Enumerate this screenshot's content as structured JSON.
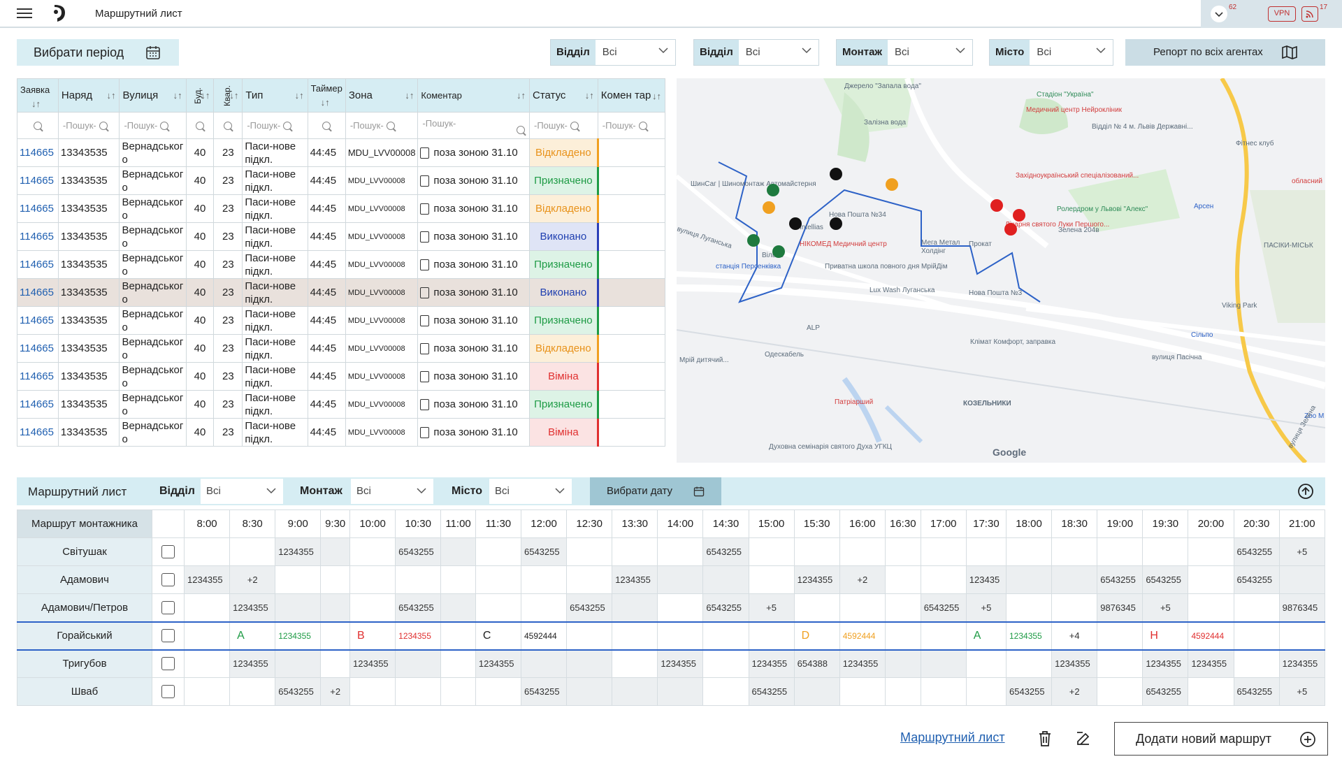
{
  "app": {
    "title": "Маршрутний лист",
    "badge_count": "62",
    "vpn_label": "VPN",
    "rss_count": "17"
  },
  "filters": {
    "period_label": "Вибрати період",
    "groups": [
      {
        "label": "Відділ",
        "value": "Всі"
      },
      {
        "label": "Відділ",
        "value": "Всі"
      },
      {
        "label": "Монтаж",
        "value": "Всі"
      },
      {
        "label": "Місто",
        "value": "Всі"
      }
    ],
    "report_label": "Репорт по всіх агентах"
  },
  "table": {
    "headers": [
      "Заявка",
      "Наряд",
      "Вулиця",
      "Буд.",
      "Квар.",
      "Тип",
      "Таймер",
      "Зона",
      "Коментар",
      "Статус",
      "Комен тар"
    ],
    "search_placeholder": "-Пошук-",
    "rows": [
      {
        "id": "114665",
        "order": "13343535",
        "street": "Вернадського",
        "bld": "40",
        "apt": "23",
        "type": "Паси-нове підкл.",
        "timer": "44:45",
        "zone": "MDU_LVV00008",
        "comment": "поза зоною 31.10",
        "status": "Відкладено",
        "s": "o"
      },
      {
        "id": "114665",
        "order": "13343535",
        "street": "Вернадського",
        "bld": "40",
        "apt": "23",
        "type": "Паси-нове підкл.",
        "timer": "44:45",
        "zone": "MDU_LVV00008",
        "comment": "поза зоною 31.10",
        "status": "Призначено",
        "s": "g"
      },
      {
        "id": "114665",
        "order": "13343535",
        "street": "Вернадського",
        "bld": "40",
        "apt": "23",
        "type": "Паси-нове підкл.",
        "timer": "44:45",
        "zone": "MDU_LVV00008",
        "comment": "поза зоною 31.10",
        "status": "Відкладено",
        "s": "o"
      },
      {
        "id": "114665",
        "order": "13343535",
        "street": "Вернадського",
        "bld": "40",
        "apt": "23",
        "type": "Паси-нове підкл.",
        "timer": "44:45",
        "zone": "MDU_LVV00008",
        "comment": "поза зоною 31.10",
        "status": "Виконано",
        "s": "b"
      },
      {
        "id": "114665",
        "order": "13343535",
        "street": "Вернадського",
        "bld": "40",
        "apt": "23",
        "type": "Паси-нове підкл.",
        "timer": "44:45",
        "zone": "MDU_LVV00008",
        "comment": "поза зоною 31.10",
        "status": "Призначено",
        "s": "g"
      },
      {
        "id": "114665",
        "order": "13343535",
        "street": "Вернадського",
        "bld": "40",
        "apt": "23",
        "type": "Паси-нове підкл.",
        "timer": "44:45",
        "zone": "MDU_LVV00008",
        "comment": "поза зоною 31.10",
        "status": "Виконано",
        "s": "b",
        "hl": true
      },
      {
        "id": "114665",
        "order": "13343535",
        "street": "Вернадського",
        "bld": "40",
        "apt": "23",
        "type": "Паси-нове підкл.",
        "timer": "44:45",
        "zone": "MDU_LVV00008",
        "comment": "поза зоною 31.10",
        "status": "Призначено",
        "s": "g"
      },
      {
        "id": "114665",
        "order": "13343535",
        "street": "Вернадського",
        "bld": "40",
        "apt": "23",
        "type": "Паси-нове підкл.",
        "timer": "44:45",
        "zone": "MDU_LVV00008",
        "comment": "поза зоною 31.10",
        "status": "Відкладено",
        "s": "o"
      },
      {
        "id": "114665",
        "order": "13343535",
        "street": "Вернадського",
        "bld": "40",
        "apt": "23",
        "type": "Паси-нове підкл.",
        "timer": "44:45",
        "zone": "MDU_LVV00008",
        "comment": "поза зоною 31.10",
        "status": "Віміна",
        "s": "r"
      },
      {
        "id": "114665",
        "order": "13343535",
        "street": "Вернадського",
        "bld": "40",
        "apt": "23",
        "type": "Паси-нове підкл.",
        "timer": "44:45",
        "zone": "MDU_LVV00008",
        "comment": "поза зоною 31.10",
        "status": "Призначено",
        "s": "g"
      },
      {
        "id": "114665",
        "order": "13343535",
        "street": "Вернадського",
        "bld": "40",
        "apt": "23",
        "type": "Паси-нове підкл.",
        "timer": "44:45",
        "zone": "MDU_LVV00008",
        "comment": "поза зоною 31.10",
        "status": "Віміна",
        "s": "r"
      }
    ]
  },
  "map": {
    "labels": [
      "Джерело \"Запала вода\"",
      "Залізна вода",
      "Стадіон \"Україна\"",
      "Медичний центр Нейрокліник",
      "Відділ № 4 м. Львів Державні...",
      "Фітнес клуб",
      "Західноукраїнський спеціалізований...",
      "обласний",
      "Арсен",
      "ШинСаг | Шиномонтаж Автомайстерня",
      "Intellias",
      "Нова Пошта №34",
      "НІКОМЕД Медичний центр",
      "Мега Метал",
      "Холдінг",
      "Прокат",
      "Лікарня святого Луки Першого...",
      "Ролердром у Львові \"Алекс\"",
      "Зелена 204в",
      "ПАСІКИ-МІСЬК",
      "вулиця Луганська",
      "Вільне",
      "станція Персенківка",
      "Приватна школа повного дня МрійДім",
      "Lux Wash Луганська",
      "Нова Пошта №3",
      "Viking Park",
      "ALP",
      "Одескабель",
      "Клімат Комфорт, заправка",
      "Сільпо",
      "вулиця Пасічна",
      "Мрій дитячий...",
      "Патріарший",
      "КОЗЕЛЬНИКИ",
      "Духовна семінарія святого Духа УГКЦ",
      "Zoo M",
      "вулиця Зелена"
    ],
    "brand": "Google"
  },
  "route": {
    "title": "Маршрутний лист",
    "filters": [
      {
        "label": "Відділ",
        "value": "Всі"
      },
      {
        "label": "Монтаж",
        "value": "Всі"
      },
      {
        "label": "Місто",
        "value": "Всі"
      }
    ],
    "date_btn": "Вибрати дату",
    "corner_label": "Маршрут монтажника",
    "times": [
      "8:00",
      "8:30",
      "9:00",
      "9:30",
      "10:00",
      "10:30",
      "11:00",
      "11:30",
      "12:00",
      "12:30",
      "13:30",
      "14:00",
      "14:30",
      "15:00",
      "15:30",
      "16:00",
      "16:30",
      "17:00",
      "17:30",
      "18:00",
      "18:30",
      "19:00",
      "19:30",
      "20:00",
      "20:30",
      "21:00"
    ],
    "rows": [
      {
        "name": "Світушак",
        "cells": [
          "",
          "",
          "1234355",
          "",
          "",
          "6543255",
          "",
          "",
          "6543255",
          "",
          "",
          "",
          "6543255",
          "",
          "",
          "",
          "",
          "",
          "",
          "",
          "",
          "",
          "",
          "",
          "6543255",
          "+5"
        ],
        "g": [
          0,
          0,
          1,
          1,
          0,
          1,
          1,
          0,
          1,
          0,
          0,
          0,
          1,
          0,
          0,
          0,
          0,
          0,
          0,
          0,
          0,
          0,
          0,
          0,
          1,
          1
        ]
      },
      {
        "name": "Адамович",
        "cells": [
          "1234355",
          "+2",
          "",
          "",
          "",
          "",
          "",
          "",
          "",
          "",
          "1234355",
          "",
          "",
          "",
          "1234355",
          "+2",
          "",
          "",
          "123435",
          "",
          "",
          "6543255",
          "6543255",
          "",
          "6543255",
          ""
        ],
        "g": [
          1,
          1,
          0,
          0,
          0,
          0,
          0,
          0,
          0,
          0,
          1,
          1,
          1,
          0,
          1,
          1,
          0,
          0,
          1,
          1,
          1,
          1,
          1,
          0,
          1,
          1
        ]
      },
      {
        "name": "Адамович/Петров",
        "cells": [
          "",
          "1234355",
          "",
          "",
          "",
          "6543255",
          "",
          "",
          "",
          "6543255",
          "",
          "",
          "6543255",
          "+5",
          "",
          "",
          "",
          "6543255",
          "+5",
          "",
          "",
          "9876345",
          "+5",
          "",
          "",
          "9876345"
        ],
        "g": [
          0,
          1,
          1,
          1,
          0,
          1,
          1,
          0,
          0,
          1,
          1,
          0,
          1,
          1,
          0,
          0,
          0,
          1,
          1,
          0,
          0,
          1,
          1,
          0,
          0,
          1
        ]
      },
      {
        "name": "Горайський",
        "cells": [
          "",
          "A",
          "1234355",
          "",
          "B",
          "1234355",
          "",
          "C",
          "4592444",
          "",
          "",
          "",
          "",
          "",
          "D",
          "4592444",
          "",
          "",
          "A",
          "1234355",
          "+4",
          "",
          "Н",
          "4592444",
          "",
          ""
        ],
        "sel": true
      },
      {
        "name": "Тригубов",
        "cells": [
          "",
          "1234355",
          "",
          "",
          "1234355",
          "",
          "",
          "1234355",
          "",
          "",
          "",
          "1234355",
          "",
          "1234355",
          "654388",
          "1234355",
          "",
          "",
          "",
          "",
          "1234355",
          "",
          "1234355",
          "1234355",
          "",
          "1234355"
        ],
        "g": [
          0,
          1,
          1,
          0,
          1,
          1,
          0,
          1,
          1,
          1,
          0,
          1,
          0,
          1,
          1,
          1,
          1,
          1,
          0,
          0,
          1,
          0,
          1,
          1,
          0,
          1
        ]
      },
      {
        "name": "Шваб",
        "cells": [
          "",
          "",
          "6543255",
          "+2",
          "",
          "",
          "",
          "",
          "6543255",
          "",
          "",
          "",
          "",
          "6543255",
          "",
          "",
          "",
          "",
          "",
          "6543255",
          "+2",
          "",
          "6543255",
          "",
          "6543255",
          "+5"
        ],
        "g": [
          0,
          0,
          1,
          1,
          0,
          0,
          0,
          0,
          1,
          1,
          1,
          1,
          0,
          1,
          1,
          0,
          0,
          0,
          0,
          1,
          1,
          0,
          1,
          0,
          1,
          1
        ]
      }
    ]
  },
  "bottom": {
    "link": "Маршрутний лист",
    "add_label": "Додати новий маршрут"
  },
  "colors": {
    "accent": "#d6edf3",
    "link": "#1f5fb0",
    "orange": "#e8921a",
    "green": "#1e9b45",
    "blue": "#1f3fb0",
    "red": "#e03030"
  }
}
